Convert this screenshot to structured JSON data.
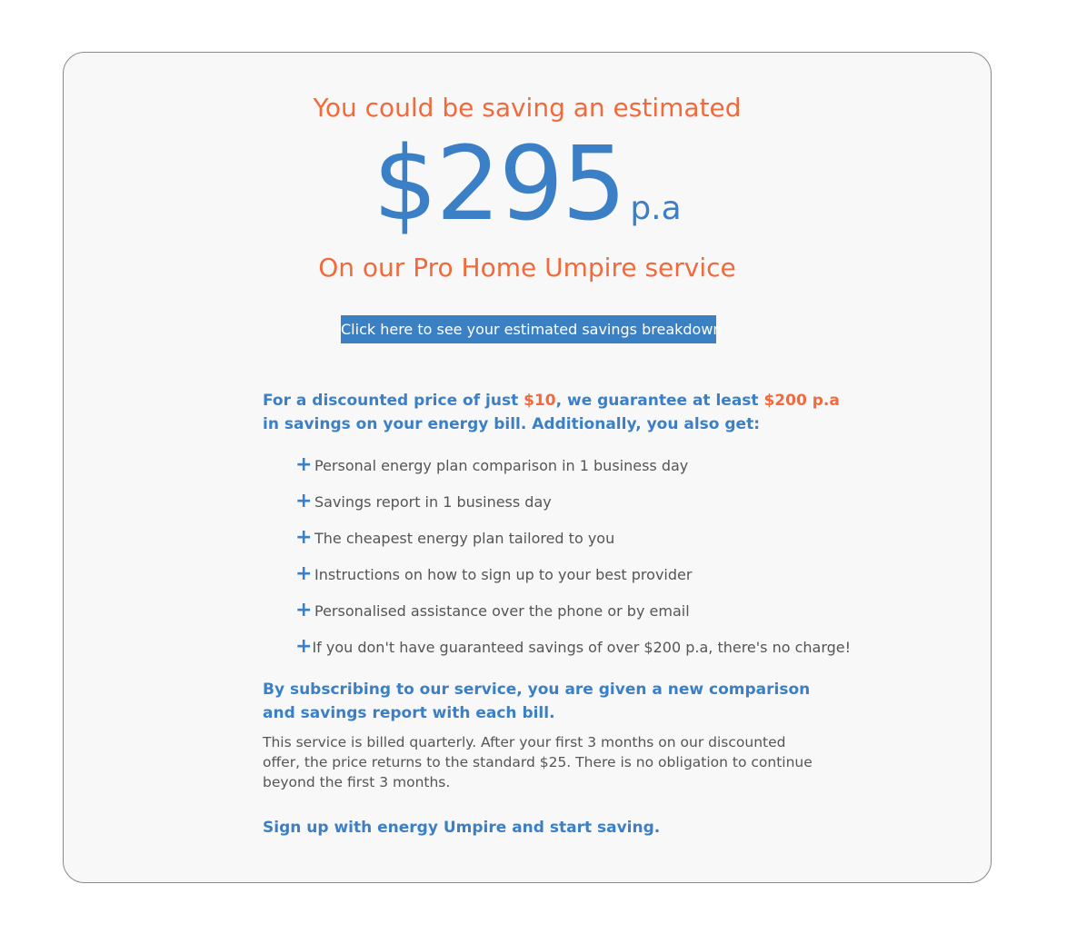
{
  "savings": {
    "headline": "You could be saving an estimated",
    "amount": "$295",
    "period": "p.a",
    "service_line": "On our Pro Home Umpire service",
    "breakdown_button": "Click here to see your estimated savings breakdown"
  },
  "offer": {
    "intro_part1": "For a discounted price of just ",
    "price": "$10",
    "intro_part2": ", we guarantee at least ",
    "guarantee": "$200 p.a",
    "intro_part3": " in savings on your energy bill. Additionally, you also get:"
  },
  "benefits": [
    "Personal energy plan comparison in 1 business day",
    "Savings report in 1 business day",
    "The cheapest energy plan tailored to you",
    "Instructions on how to sign up to your best provider",
    "Personalised assistance over the phone or by email",
    "If you don't have guaranteed savings of over $200 p.a, there's no charge!"
  ],
  "subscription": {
    "heading": "By subscribing to our service, you are given a new comparison and savings report with each bill.",
    "billing_note": "This service is billed quarterly. After your first 3 months on our discounted offer, the price returns to the standard $25. There is no obligation to continue beyond the first 3 months.",
    "signup": "Sign up with energy Umpire and start saving."
  },
  "colors": {
    "accent_orange": "#f26a3c",
    "brand_blue": "#3b80c6",
    "card_background": "#f8f8f8"
  },
  "icons": {
    "benefit_bullet": "plus-icon"
  }
}
